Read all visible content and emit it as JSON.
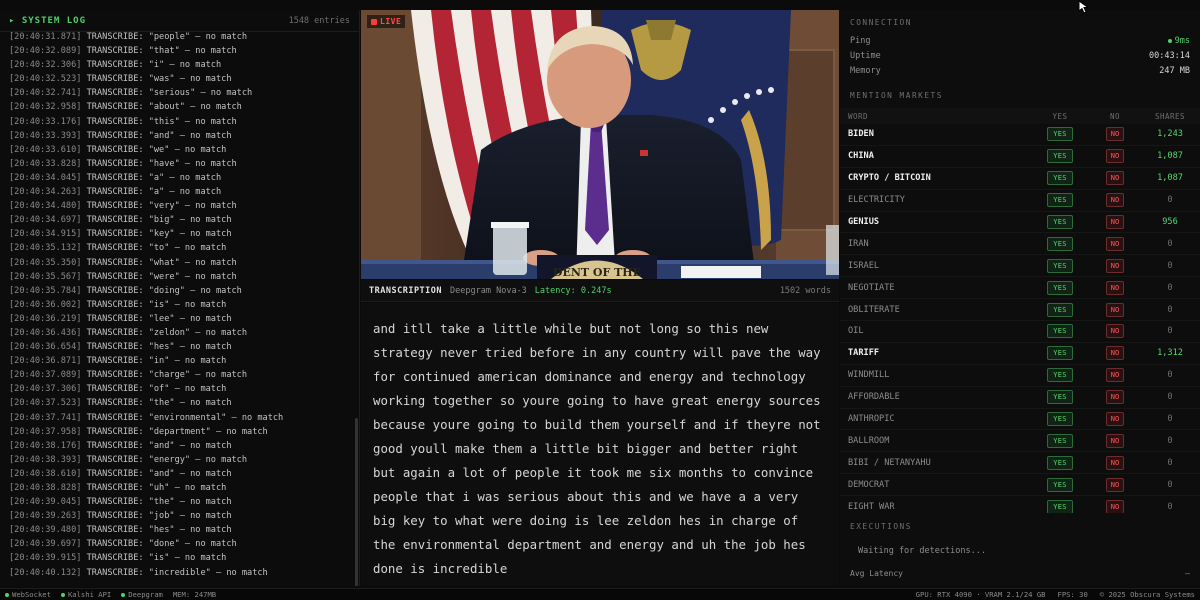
{
  "system_log": {
    "title": "▸ SYSTEM LOG",
    "entry_count": "1548 entries",
    "lines": [
      {
        "ts": "[20:40:31.871]",
        "msg": "TRANSCRIBE: \"people\" — no match"
      },
      {
        "ts": "[20:40:32.089]",
        "msg": "TRANSCRIBE: \"that\" — no match"
      },
      {
        "ts": "[20:40:32.306]",
        "msg": "TRANSCRIBE: \"i\" — no match"
      },
      {
        "ts": "[20:40:32.523]",
        "msg": "TRANSCRIBE: \"was\" — no match"
      },
      {
        "ts": "[20:40:32.741]",
        "msg": "TRANSCRIBE: \"serious\" — no match"
      },
      {
        "ts": "[20:40:32.958]",
        "msg": "TRANSCRIBE: \"about\" — no match"
      },
      {
        "ts": "[20:40:33.176]",
        "msg": "TRANSCRIBE: \"this\" — no match"
      },
      {
        "ts": "[20:40:33.393]",
        "msg": "TRANSCRIBE: \"and\" — no match"
      },
      {
        "ts": "[20:40:33.610]",
        "msg": "TRANSCRIBE: \"we\" — no match"
      },
      {
        "ts": "[20:40:33.828]",
        "msg": "TRANSCRIBE: \"have\" — no match"
      },
      {
        "ts": "[20:40:34.045]",
        "msg": "TRANSCRIBE: \"a\" — no match"
      },
      {
        "ts": "[20:40:34.263]",
        "msg": "TRANSCRIBE: \"a\" — no match"
      },
      {
        "ts": "[20:40:34.480]",
        "msg": "TRANSCRIBE: \"very\" — no match"
      },
      {
        "ts": "[20:40:34.697]",
        "msg": "TRANSCRIBE: \"big\" — no match"
      },
      {
        "ts": "[20:40:34.915]",
        "msg": "TRANSCRIBE: \"key\" — no match"
      },
      {
        "ts": "[20:40:35.132]",
        "msg": "TRANSCRIBE: \"to\" — no match"
      },
      {
        "ts": "[20:40:35.350]",
        "msg": "TRANSCRIBE: \"what\" — no match"
      },
      {
        "ts": "[20:40:35.567]",
        "msg": "TRANSCRIBE: \"were\" — no match"
      },
      {
        "ts": "[20:40:35.784]",
        "msg": "TRANSCRIBE: \"doing\" — no match"
      },
      {
        "ts": "[20:40:36.002]",
        "msg": "TRANSCRIBE: \"is\" — no match"
      },
      {
        "ts": "[20:40:36.219]",
        "msg": "TRANSCRIBE: \"lee\" — no match"
      },
      {
        "ts": "[20:40:36.436]",
        "msg": "TRANSCRIBE: \"zeldon\" — no match"
      },
      {
        "ts": "[20:40:36.654]",
        "msg": "TRANSCRIBE: \"hes\" — no match"
      },
      {
        "ts": "[20:40:36.871]",
        "msg": "TRANSCRIBE: \"in\" — no match"
      },
      {
        "ts": "[20:40:37.089]",
        "msg": "TRANSCRIBE: \"charge\" — no match"
      },
      {
        "ts": "[20:40:37.306]",
        "msg": "TRANSCRIBE: \"of\" — no match"
      },
      {
        "ts": "[20:40:37.523]",
        "msg": "TRANSCRIBE: \"the\" — no match"
      },
      {
        "ts": "[20:40:37.741]",
        "msg": "TRANSCRIBE: \"environmental\" — no match"
      },
      {
        "ts": "[20:40:37.958]",
        "msg": "TRANSCRIBE: \"department\" — no match"
      },
      {
        "ts": "[20:40:38.176]",
        "msg": "TRANSCRIBE: \"and\" — no match"
      },
      {
        "ts": "[20:40:38.393]",
        "msg": "TRANSCRIBE: \"energy\" — no match"
      },
      {
        "ts": "[20:40:38.610]",
        "msg": "TRANSCRIBE: \"and\" — no match"
      },
      {
        "ts": "[20:40:38.828]",
        "msg": "TRANSCRIBE: \"uh\" — no match"
      },
      {
        "ts": "[20:40:39.045]",
        "msg": "TRANSCRIBE: \"the\" — no match"
      },
      {
        "ts": "[20:40:39.263]",
        "msg": "TRANSCRIBE: \"job\" — no match"
      },
      {
        "ts": "[20:40:39.480]",
        "msg": "TRANSCRIBE: \"hes\" — no match"
      },
      {
        "ts": "[20:40:39.697]",
        "msg": "TRANSCRIBE: \"done\" — no match"
      },
      {
        "ts": "[20:40:39.915]",
        "msg": "TRANSCRIBE: \"is\" — no match"
      },
      {
        "ts": "[20:40:40.132]",
        "msg": "TRANSCRIBE: \"incredible\" — no match"
      }
    ]
  },
  "video": {
    "live_label": "LIVE",
    "seal_text": "DENT OF THE"
  },
  "transcription": {
    "title": "TRANSCRIPTION",
    "model": "Deepgram Nova-3",
    "latency": "Latency: 0.247s",
    "word_count": "1502 words",
    "text": "and itll take a little while but not long so this new strategy never tried before in any country will pave the way for continued american dominance and energy and technology working together so youre going to have great energy sources because youre going to build them yourself and if theyre not good youll make them a little bit bigger and better right but again a lot of people it took me six months to convince people that i was serious about this and we have a a very big key to what were doing is lee zeldon hes in charge of the environmental department and energy and uh the job hes done is incredible"
  },
  "connection": {
    "label": "CONNECTION",
    "ping_label": "Ping",
    "ping_value": "9ms",
    "uptime_label": "Uptime",
    "uptime_value": "00:43:14",
    "memory_label": "Memory",
    "memory_value": "247 MB"
  },
  "markets": {
    "label": "MENTION MARKETS",
    "headers": {
      "word": "WORD",
      "yes": "YES",
      "no": "NO",
      "shares": "SHARES"
    },
    "rows": [
      {
        "word": "BIDEN",
        "bold": true,
        "yes": "YES",
        "no": "NO",
        "shares": "1,243"
      },
      {
        "word": "CHINA",
        "bold": true,
        "yes": "YES",
        "no": "NO",
        "shares": "1,087"
      },
      {
        "word": "CRYPTO / BITCOIN",
        "bold": true,
        "yes": "YES",
        "no": "NO",
        "shares": "1,087"
      },
      {
        "word": "ELECTRICITY",
        "bold": false,
        "yes": "YES",
        "no": "NO",
        "shares": "0"
      },
      {
        "word": "GENIUS",
        "bold": true,
        "yes": "YES",
        "no": "NO",
        "shares": "956"
      },
      {
        "word": "IRAN",
        "bold": false,
        "yes": "YES",
        "no": "NO",
        "shares": "0"
      },
      {
        "word": "ISRAEL",
        "bold": false,
        "yes": "YES",
        "no": "NO",
        "shares": "0"
      },
      {
        "word": "NEGOTIATE",
        "bold": false,
        "yes": "YES",
        "no": "NO",
        "shares": "0"
      },
      {
        "word": "OBLITERATE",
        "bold": false,
        "yes": "YES",
        "no": "NO",
        "shares": "0"
      },
      {
        "word": "OIL",
        "bold": false,
        "yes": "YES",
        "no": "NO",
        "shares": "0"
      },
      {
        "word": "TARIFF",
        "bold": true,
        "yes": "YES",
        "no": "NO",
        "shares": "1,312"
      },
      {
        "word": "WINDMILL",
        "bold": false,
        "yes": "YES",
        "no": "NO",
        "shares": "0"
      },
      {
        "word": "AFFORDABLE",
        "bold": false,
        "yes": "YES",
        "no": "NO",
        "shares": "0"
      },
      {
        "word": "ANTHROPIC",
        "bold": false,
        "yes": "YES",
        "no": "NO",
        "shares": "0"
      },
      {
        "word": "BALLROOM",
        "bold": false,
        "yes": "YES",
        "no": "NO",
        "shares": "0"
      },
      {
        "word": "BIBI / NETANYAHU",
        "bold": false,
        "yes": "YES",
        "no": "NO",
        "shares": "0"
      },
      {
        "word": "DEMOCRAT",
        "bold": false,
        "yes": "YES",
        "no": "NO",
        "shares": "0"
      },
      {
        "word": "EIGHT WAR",
        "bold": false,
        "yes": "YES",
        "no": "NO",
        "shares": "0"
      }
    ]
  },
  "executions": {
    "label": "EXECUTIONS",
    "status": "Waiting for detections...",
    "avg_label": "Avg Latency",
    "avg_value": "—"
  },
  "status_bar": {
    "items": [
      "WebSocket",
      "Kalshi API",
      "Deepgram"
    ],
    "memory": "MEM: 247MB",
    "gpu": "GPU: RTX 4090 · VRAM 2.1/24 GB",
    "fps": "FPS: 30",
    "copyright": "© 2025 Obscura Systems"
  },
  "colors": {
    "accent_green": "#4fd16b",
    "live_red": "#ff3b3b",
    "no_red": "#ff5a5a"
  }
}
